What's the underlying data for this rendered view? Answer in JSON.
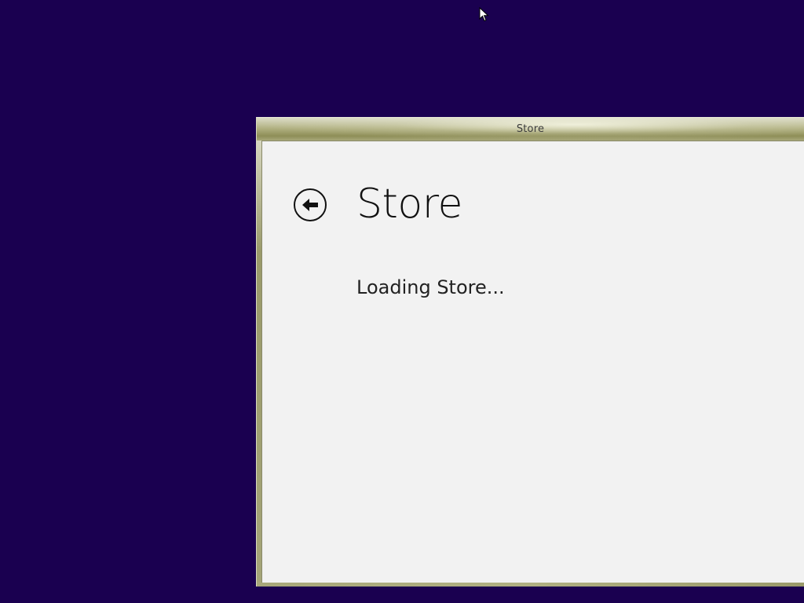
{
  "window": {
    "title": "Store"
  },
  "page": {
    "title": "Store",
    "status_text": "Loading Store..."
  },
  "icons": {
    "back": "back-arrow-icon",
    "cursor": "mouse-pointer-icon"
  },
  "colors": {
    "desktop_background": "#1a0050",
    "client_background": "#f2f2f2",
    "frame_accent": "#a8a874"
  }
}
